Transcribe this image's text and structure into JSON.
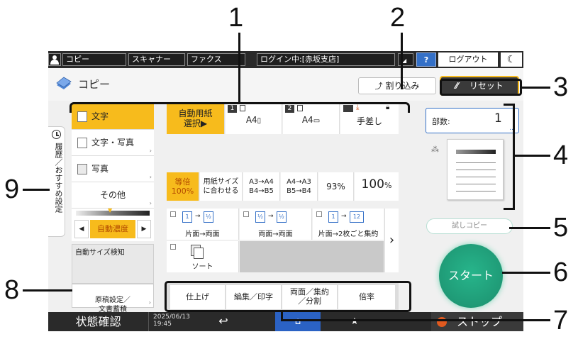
{
  "topbar": {
    "tabs": [
      "コピー",
      "スキャナー",
      "ファクス"
    ],
    "login_status": "ログイン中:[赤坂支店]",
    "help_label": "?",
    "logout_label": "ログアウト"
  },
  "header": {
    "title": "コピー",
    "interrupt_label": "割り込み",
    "reset_label": "リセット"
  },
  "original_type": {
    "items": [
      "文字",
      "文字・写真",
      "写真",
      "その他"
    ],
    "selected": "文字"
  },
  "sidebar_tab": {
    "label": "履歴／おすすめ設定"
  },
  "density": {
    "label": "自動濃度"
  },
  "auto_size_label": "自動サイズ検知",
  "original_settings_label": "原稿設定／\n文書蓄積",
  "paper": {
    "items": [
      {
        "label": "自動用紙\n選択▶",
        "tray": ""
      },
      {
        "label": "A4",
        "tray": "1"
      },
      {
        "label": "A4",
        "tray": "2"
      },
      {
        "label": "手差し",
        "tray": ""
      }
    ]
  },
  "ratio": {
    "items": [
      "等倍\n100%",
      "用紙サイズ\nに合わせる",
      "A3→A4\nB4→B5",
      "A4→A3\nB5→B4",
      "93%"
    ],
    "value": "100",
    "unit": "%"
  },
  "duplex": {
    "items": [
      "片面→両面",
      "両面→両面",
      "片面→2枚ごと集約",
      "ソート"
    ]
  },
  "bottom_tabs": [
    "仕上げ",
    "編集／印字",
    "両面／集約\n／分割",
    "倍率"
  ],
  "right_panel": {
    "copies_label": "部数:",
    "copies_value": "1",
    "sample_copy_label": "試しコピー",
    "start_label": "スタート"
  },
  "statusbar": {
    "status_label": "状態確認",
    "datetime": "2025/06/13\n19:45",
    "stop_label": "ストップ"
  },
  "callouts": [
    "1",
    "2",
    "3",
    "4",
    "5",
    "6",
    "7",
    "8",
    "9"
  ],
  "colors": {
    "accent_yellow": "#f7bb1c",
    "start_green": "#1f9a76",
    "dark_bar": "#2a2a2a",
    "selected_text": "#b34a00",
    "link_blue": "#3470c7"
  }
}
